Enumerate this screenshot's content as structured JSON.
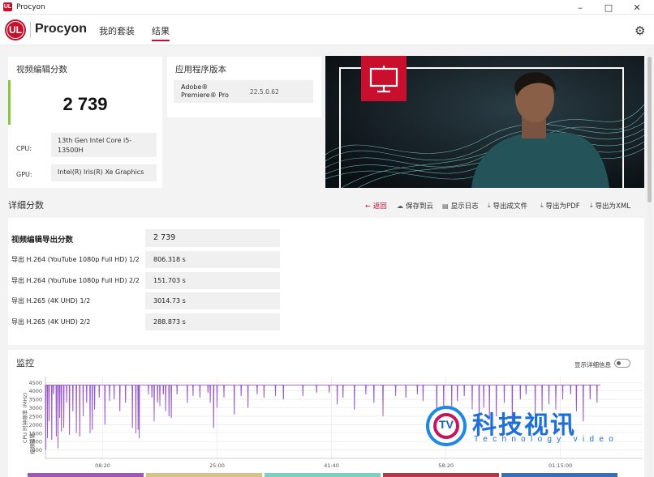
{
  "window": {
    "title": "Procyon",
    "app_icon": "UL"
  },
  "header": {
    "logo_text": "UL",
    "brand": "Procyon",
    "tabs": [
      {
        "label": "我的套装",
        "active": false
      },
      {
        "label": "结果",
        "active": true
      }
    ],
    "settings_icon": "gear-icon"
  },
  "score_card": {
    "title": "视频编辑分数",
    "score": "2 739",
    "cpu_label": "CPU:",
    "cpu_value": "13th Gen Intel Core i5-13500H",
    "gpu_label": "GPU:",
    "gpu_value": "Intel(R) Iris(R) Xe Graphics"
  },
  "version_card": {
    "title": "应用程序版本",
    "app_name": "Adobe® Premiere® Pro",
    "app_version": "22.5.0.62"
  },
  "details": {
    "title": "详细分数",
    "toolbar": [
      {
        "label": "返回",
        "icon": "arrow-left-icon"
      },
      {
        "label": "保存到云",
        "icon": "cloud-upload-icon"
      },
      {
        "label": "显示日志",
        "icon": "document-icon"
      },
      {
        "label": "导出成文件",
        "icon": "download-icon"
      },
      {
        "label": "导出为PDF",
        "icon": "download-icon"
      },
      {
        "label": "导出为XML",
        "icon": "download-icon"
      }
    ],
    "rows": [
      {
        "label": "视频编辑导出分数",
        "value": "2 739"
      },
      {
        "label": "导出 H.264 (YouTube 1080p Full HD) 1/2",
        "value": "806.318 s"
      },
      {
        "label": "导出 H.264 (YouTube 1080p Full HD) 2/2",
        "value": "151.703 s"
      },
      {
        "label": "导出 H.265 (4K UHD) 1/2",
        "value": "3014.73 s"
      },
      {
        "label": "导出 H.265 (4K UHD) 2/2",
        "value": "288.873 s"
      }
    ]
  },
  "monitoring": {
    "title": "监控",
    "toggle_label": "显示详细信息",
    "toggle_on": false
  },
  "chart_data": {
    "type": "line",
    "ylabel": "CPU 时钟频率 (MHz)",
    "side_label": "视频编辑",
    "y_ticks": [
      500,
      1000,
      1500,
      2000,
      2500,
      3000,
      3500,
      4000,
      4500
    ],
    "ylim": [
      0,
      4800
    ],
    "x_ticks": [
      "08:20",
      "25:00",
      "41:40",
      "58:20",
      "01:15:00"
    ],
    "x_tick_seconds": [
      500,
      1500,
      2500,
      3500,
      4500
    ],
    "xlim_seconds": [
      0,
      4850
    ],
    "baseline": 4350,
    "series_color": "#9b59d0",
    "grid": true,
    "dips": [
      [
        2,
        2900
      ],
      [
        3,
        500
      ],
      [
        18,
        1200
      ],
      [
        32,
        2200
      ],
      [
        55,
        1100
      ],
      [
        70,
        3800
      ],
      [
        95,
        1300
      ],
      [
        110,
        600
      ],
      [
        125,
        2400
      ],
      [
        140,
        1600
      ],
      [
        160,
        1800
      ],
      [
        185,
        3300
      ],
      [
        210,
        1400
      ],
      [
        240,
        2800
      ],
      [
        270,
        1500
      ],
      [
        300,
        1300
      ],
      [
        330,
        2500
      ],
      [
        360,
        3300
      ],
      [
        390,
        1500
      ],
      [
        410,
        1700
      ],
      [
        430,
        2900
      ],
      [
        470,
        3600
      ],
      [
        520,
        2000
      ],
      [
        560,
        3400
      ],
      [
        600,
        3500
      ],
      [
        650,
        2800
      ],
      [
        700,
        3300
      ],
      [
        760,
        1800
      ],
      [
        790,
        1500
      ],
      [
        810,
        1700
      ],
      [
        820,
        1200
      ],
      [
        900,
        3800
      ],
      [
        930,
        3600
      ],
      [
        950,
        2200
      ],
      [
        980,
        3300
      ],
      [
        1000,
        3100
      ],
      [
        1030,
        3800
      ],
      [
        1050,
        2800
      ],
      [
        1080,
        2500
      ],
      [
        1100,
        2400
      ],
      [
        1150,
        3800
      ],
      [
        1240,
        3300
      ],
      [
        1290,
        3700
      ],
      [
        1350,
        3600
      ],
      [
        1420,
        3900
      ],
      [
        1440,
        3300
      ],
      [
        1470,
        1800
      ],
      [
        1500,
        3000
      ],
      [
        1560,
        3600
      ],
      [
        1650,
        2600
      ],
      [
        1710,
        3700
      ],
      [
        1770,
        3000
      ],
      [
        1850,
        3800
      ],
      [
        1910,
        3600
      ],
      [
        2010,
        3700
      ],
      [
        2080,
        3500
      ],
      [
        2250,
        3700
      ],
      [
        2370,
        3900
      ],
      [
        2480,
        3900
      ],
      [
        2550,
        3200
      ],
      [
        2600,
        3600
      ],
      [
        2700,
        2900
      ],
      [
        2800,
        3800
      ],
      [
        2870,
        3300
      ],
      [
        2950,
        2500
      ],
      [
        3060,
        3700
      ],
      [
        3150,
        3600
      ],
      [
        3250,
        3800
      ],
      [
        3300,
        3400
      ],
      [
        3420,
        2000
      ],
      [
        3480,
        3100
      ],
      [
        3550,
        3000
      ],
      [
        3600,
        3400
      ],
      [
        3660,
        3700
      ],
      [
        3730,
        2900
      ],
      [
        3790,
        1400
      ],
      [
        3830,
        3000
      ],
      [
        3880,
        2300
      ],
      [
        3940,
        2500
      ],
      [
        4010,
        3300
      ],
      [
        4080,
        1700
      ],
      [
        4150,
        3500
      ],
      [
        4200,
        3800
      ],
      [
        4280,
        2600
      ],
      [
        4340,
        2800
      ],
      [
        4400,
        3200
      ],
      [
        4460,
        2900
      ],
      [
        4520,
        3500
      ],
      [
        4590,
        3800
      ],
      [
        4640,
        2800
      ],
      [
        4700,
        2200
      ],
      [
        4760,
        3500
      ],
      [
        4820,
        3300
      ]
    ]
  },
  "watermark": {
    "logo_text": "TV",
    "cn_text": "科技视讯",
    "en_text": "Technology video"
  }
}
